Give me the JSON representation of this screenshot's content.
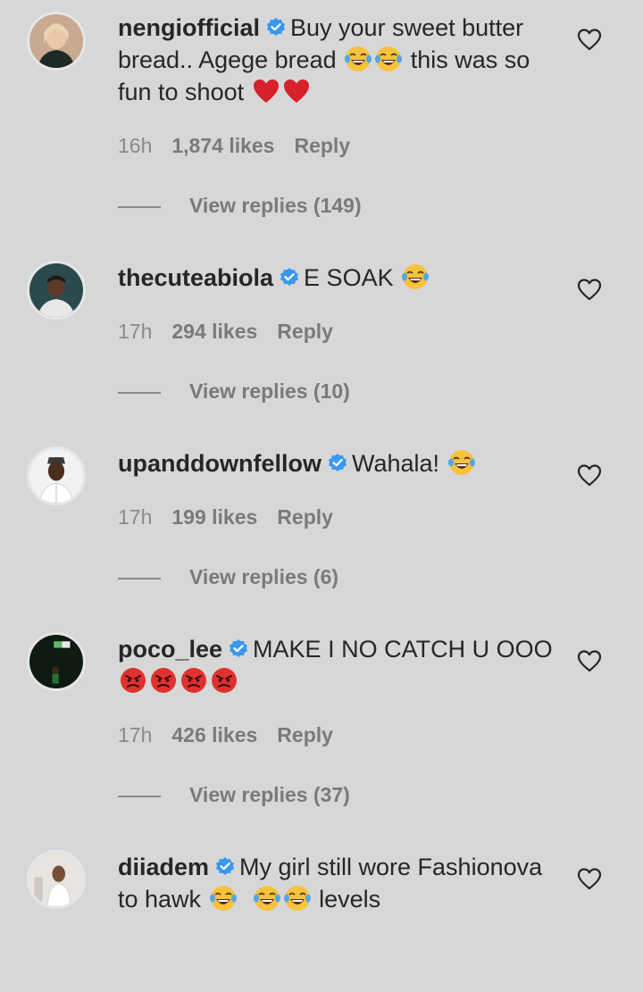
{
  "comments": [
    {
      "username": "nengiofficial",
      "text_parts": [
        "Buy your sweet butter bread.. Agege bread ",
        " this was so fun to shoot "
      ],
      "time": "16h",
      "likes": "1,874 likes",
      "reply": "Reply",
      "view_replies": "View replies (149)"
    },
    {
      "username": "thecuteabiola",
      "text_parts": [
        "E SOAK "
      ],
      "time": "17h",
      "likes": "294 likes",
      "reply": "Reply",
      "view_replies": "View replies (10)"
    },
    {
      "username": "upanddownfellow",
      "text_parts": [
        "Wahala! "
      ],
      "time": "17h",
      "likes": "199 likes",
      "reply": "Reply",
      "view_replies": "View replies (6)"
    },
    {
      "username": "poco_lee",
      "text_parts": [
        "MAKE I NO CATCH U OOO "
      ],
      "time": "17h",
      "likes": "426 likes",
      "reply": "Reply",
      "view_replies": "View replies (37)"
    },
    {
      "username": "diiadem",
      "text_parts": [
        "My girl still wore Fashionova to hawk ",
        " levels"
      ]
    }
  ],
  "icons": {
    "verified": "verified-badge-icon",
    "heart": "heart-outline-icon",
    "laugh": "tears-of-joy-emoji",
    "red_heart": "red-heart-emoji",
    "angry": "angry-face-emoji"
  },
  "colors": {
    "background": "#d7d7d7",
    "verified_blue": "#3897f0",
    "meta_gray": "#7a7a7a"
  }
}
